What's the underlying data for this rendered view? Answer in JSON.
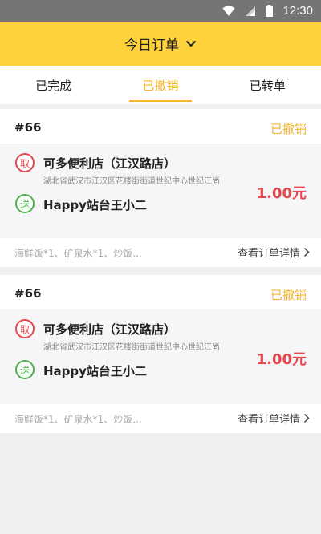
{
  "status_bar": {
    "time": "12:30",
    "icons": [
      "wifi-icon",
      "signal-icon",
      "battery-icon"
    ]
  },
  "header": {
    "title": "今日订单",
    "dropdown_icon": "chevron-down-icon"
  },
  "tabs": [
    {
      "label": "已完成",
      "active": false
    },
    {
      "label": "已撤销",
      "active": true
    },
    {
      "label": "已转单",
      "active": false
    }
  ],
  "orders": [
    {
      "number": "#66",
      "status": "已撤销",
      "pickup_badge": "取",
      "store_name": "可多便利店（江汉路店）",
      "store_address": "湖北省武汉市江汉区花楼街街道世纪中心世纪江尚",
      "delivery_badge": "送",
      "receiver": "Happy站台王小二",
      "price": "1.00元",
      "items": "海鲜饭*1、矿泉水*1、炒饭...",
      "detail_link": "查看订单详情"
    },
    {
      "number": "#66",
      "status": "已撤销",
      "pickup_badge": "取",
      "store_name": "可多便利店（江汉路店）",
      "store_address": "湖北省武汉市江汉区花楼街街道世纪中心世纪江尚",
      "delivery_badge": "送",
      "receiver": "Happy站台王小二",
      "price": "1.00元",
      "items": "海鲜饭*1、矿泉水*1、炒饭...",
      "detail_link": "查看订单详情"
    }
  ],
  "colors": {
    "header_bg": "#fdd23c",
    "accent": "#f3b62d",
    "price": "#e5484d",
    "pickup": "#e5484d",
    "delivery": "#4cb24c"
  }
}
